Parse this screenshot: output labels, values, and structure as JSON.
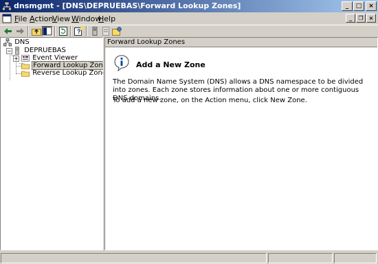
{
  "window": {
    "title": "dnsmgmt - [DNS\\DEPRUEBAS\\Forward Lookup Zones]"
  },
  "caption_buttons": {
    "minimize": "_",
    "maximize": "□",
    "close": "×"
  },
  "menu": [
    {
      "accel": "F",
      "rest": "ile"
    },
    {
      "accel": "A",
      "rest": "ction"
    },
    {
      "accel": "V",
      "rest": "iew"
    },
    {
      "accel": "W",
      "rest": "indow"
    },
    {
      "accel": "H",
      "rest": "elp"
    }
  ],
  "mdi_buttons": {
    "minimize": "_",
    "restore": "❐",
    "close": "×"
  },
  "toolbar": [
    "back-icon",
    "forward-icon",
    "up-folder-icon",
    "show-hide-tree-icon",
    "refresh-icon",
    "help-icon",
    "server-icon",
    "list-icon",
    "new-zone-icon"
  ],
  "tree": {
    "root": "DNS",
    "server": "DEPRUEBAS",
    "items": [
      {
        "label": "Event Viewer",
        "expander": "+"
      },
      {
        "label": "Forward Lookup Zones",
        "selected": true
      },
      {
        "label": "Reverse Lookup Zones"
      }
    ],
    "server_expander": "−"
  },
  "content": {
    "header": "Forward Lookup Zones",
    "title": "Add a New Zone",
    "paragraph1": "The Domain Name System (DNS) allows a DNS namespace to be divided into zones. Each zone stores information about one or more contiguous DNS domains.",
    "paragraph2": "To add a new zone, on the Action menu, click New Zone."
  },
  "colors": {
    "titlebar_start": "#0a246a",
    "titlebar_end": "#a6caf0",
    "face": "#d4d0c8"
  }
}
